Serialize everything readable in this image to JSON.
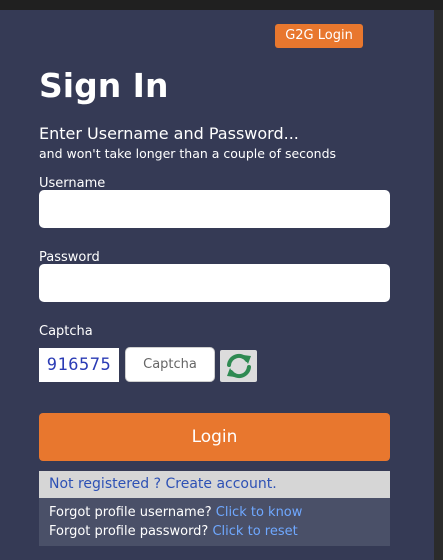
{
  "header": {
    "g2g_label": "G2G Login"
  },
  "form": {
    "title": "Sign In",
    "subtitle": "Enter Username and Password...",
    "subtitle_small": "and won't take longer than a couple of seconds",
    "username_label": "Username",
    "username_value": "",
    "password_label": "Password",
    "password_value": "",
    "captcha_label": "Captcha",
    "captcha_code": "916575",
    "captcha_placeholder": "Captcha",
    "refresh_icon": "refresh-icon",
    "login_label": "Login"
  },
  "footer": {
    "register_link": "Not registered ? Create account.",
    "forgot_username_text": "Forgot profile username?",
    "forgot_username_link": "Click to know",
    "forgot_password_text": "Forgot profile password?",
    "forgot_password_link": "Click to reset"
  },
  "colors": {
    "panel": "#353a55",
    "accent": "#e8772e",
    "link": "#6fa8ff"
  }
}
